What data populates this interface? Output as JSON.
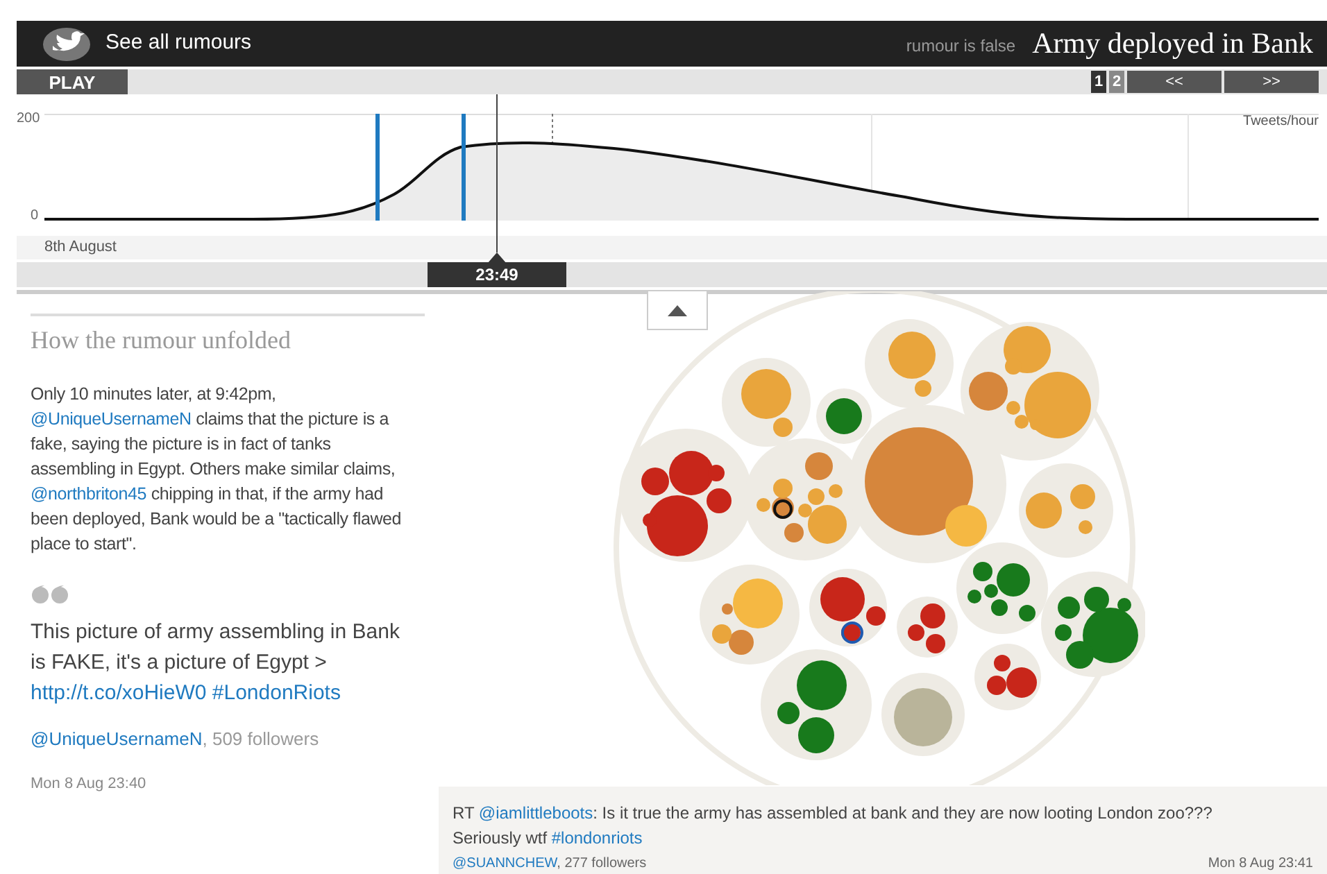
{
  "header": {
    "back_link": "See all rumours",
    "verdict": "rumour is false",
    "title": "Army deployed in Bank"
  },
  "controls": {
    "play": "PLAY",
    "pages": [
      {
        "label": "1",
        "selected": true
      },
      {
        "label": "2",
        "selected": false
      }
    ],
    "prev": "<<",
    "next": ">>"
  },
  "chart": {
    "y_max": "200",
    "y_min": "0",
    "unit": "Tweets/hour",
    "date": "8th August",
    "time": "23:49"
  },
  "story": {
    "heading": "How the rumour unfolded",
    "paragraph": [
      {
        "kind": "text",
        "text": "Only 10 minutes later, at 9:42pm, "
      },
      {
        "kind": "link",
        "text": "@UniqueUsernameN"
      },
      {
        "kind": "text",
        "text": " claims that the picture is a fake, saying the picture is in fact of tanks assembling in Egypt. Others make similar claims, "
      },
      {
        "kind": "link",
        "text": "@northbriton45"
      },
      {
        "kind": "text",
        "text": " chipping in that, if the army had been deployed, Bank would be a \"tactically flawed place to start\"."
      }
    ],
    "quote": [
      {
        "kind": "text",
        "text": "This picture of army assembling in Bank is FAKE, it's a picture of Egypt > "
      },
      {
        "kind": "link",
        "text": "http://t.co/xoHieW0"
      },
      {
        "kind": "link",
        "text": "#LondonRiots"
      }
    ],
    "author": "@UniqueUsernameN",
    "followers": ", 509 followers",
    "time": "Mon 8 Aug 23:40"
  },
  "tweet": {
    "text": [
      {
        "kind": "text",
        "text": "RT "
      },
      {
        "kind": "link",
        "text": "@iamlittleboots"
      },
      {
        "kind": "text",
        "text": ": Is it true the army has assembled at bank and they are now looting London zoo??? Seriously wtf "
      },
      {
        "kind": "link",
        "text": "#londonriots"
      }
    ],
    "author": "@SUANNCHEW",
    "followers": ", 277 followers",
    "time": "Mon 8 Aug 23:41"
  }
}
